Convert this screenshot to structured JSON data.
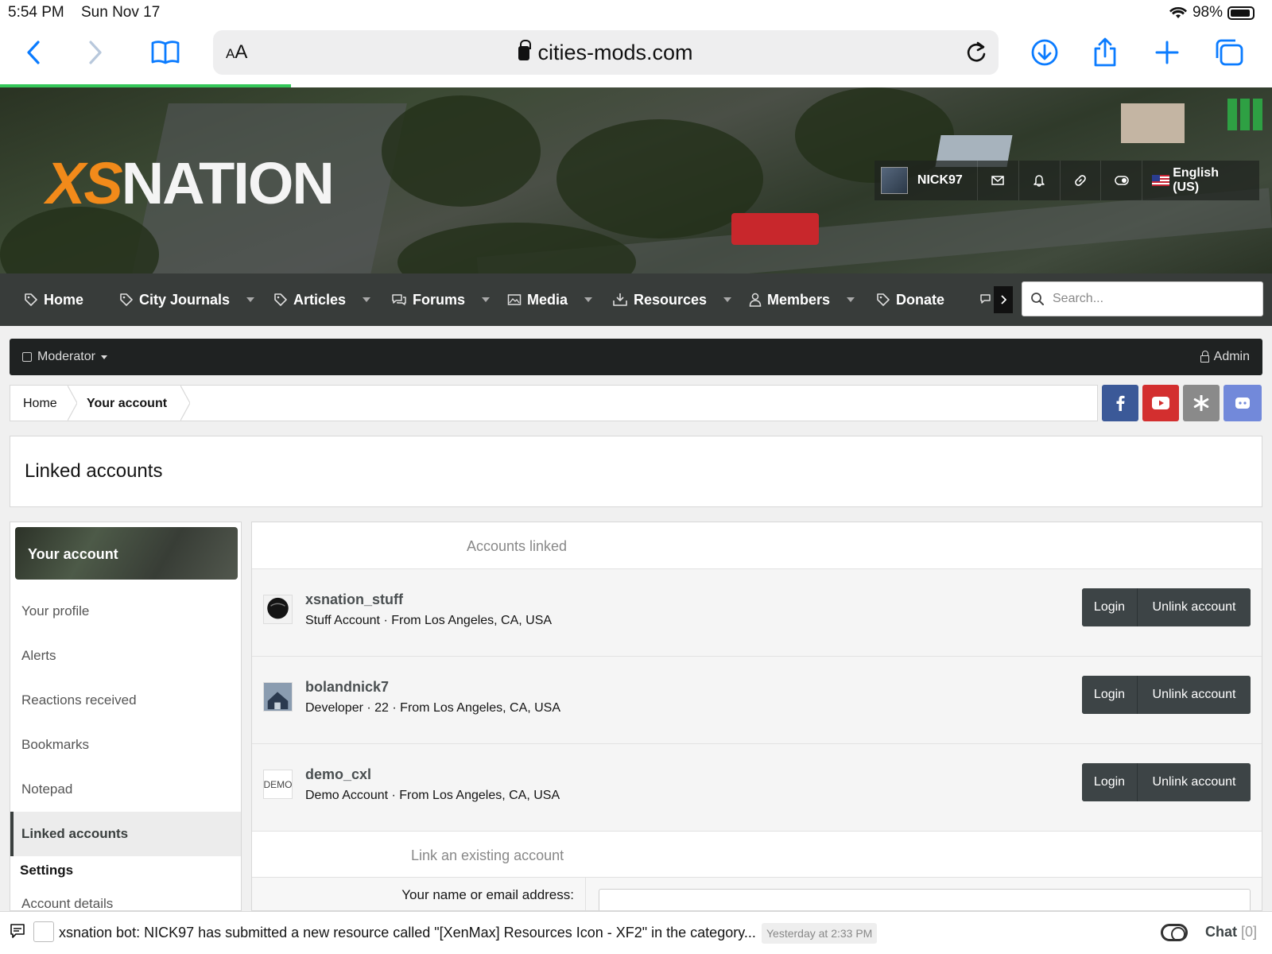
{
  "status_bar": {
    "time": "5:54 PM",
    "date": "Sun Nov 17",
    "battery": "98%"
  },
  "browser": {
    "text_size": "AA",
    "host": "cities-mods.com"
  },
  "header": {
    "logo_xs": "XS",
    "logo_nation": "NATION",
    "username": "NICK97",
    "language": "English (US)"
  },
  "nav": {
    "items": [
      "Home",
      "City Journals",
      "Articles",
      "Forums",
      "Media",
      "Resources",
      "Members",
      "Donate"
    ],
    "search_placeholder": "Search..."
  },
  "modbar": {
    "moderator": "Moderator",
    "admin": "Admin"
  },
  "breadcrumb": {
    "home": "Home",
    "current": "Your account"
  },
  "page_title": "Linked accounts",
  "sidebar": {
    "heading": "Your account",
    "items": [
      "Your profile",
      "Alerts",
      "Reactions received",
      "Bookmarks",
      "Notepad",
      "Linked accounts"
    ],
    "settings_heading": "Settings",
    "partial_item": "Account details"
  },
  "main": {
    "accounts_heading": "Accounts linked",
    "accounts": [
      {
        "name": "xsnation_stuff",
        "meta": "Stuff Account · From Los Angeles, CA, USA"
      },
      {
        "name": "bolandnick7",
        "meta": "Developer · 22 · From Los Angeles, CA, USA"
      },
      {
        "name": "demo_cxl",
        "meta": "Demo Account · From Los Angeles, CA, USA",
        "avatar_text": "DEMO"
      }
    ],
    "login_label": "Login",
    "unlink_label": "Unlink account",
    "link_heading": "Link an existing account",
    "form_label": "Your name or email address:"
  },
  "chat": {
    "message": "xsnation bot: NICK97 has submitted a new resource called \"[XenMax] Resources Icon - XF2\" in the category...",
    "timestamp": "Yesterday at 2:33 PM",
    "label": "Chat",
    "count": "[0]"
  },
  "colors": {
    "accent": "#3d4446",
    "facebook": "#3b5998",
    "youtube": "#d32f2f",
    "other_social": "#8a8a8a",
    "discord": "#7289da",
    "safari_blue": "#0a7bff",
    "logo_orange": "#f28a1a"
  }
}
